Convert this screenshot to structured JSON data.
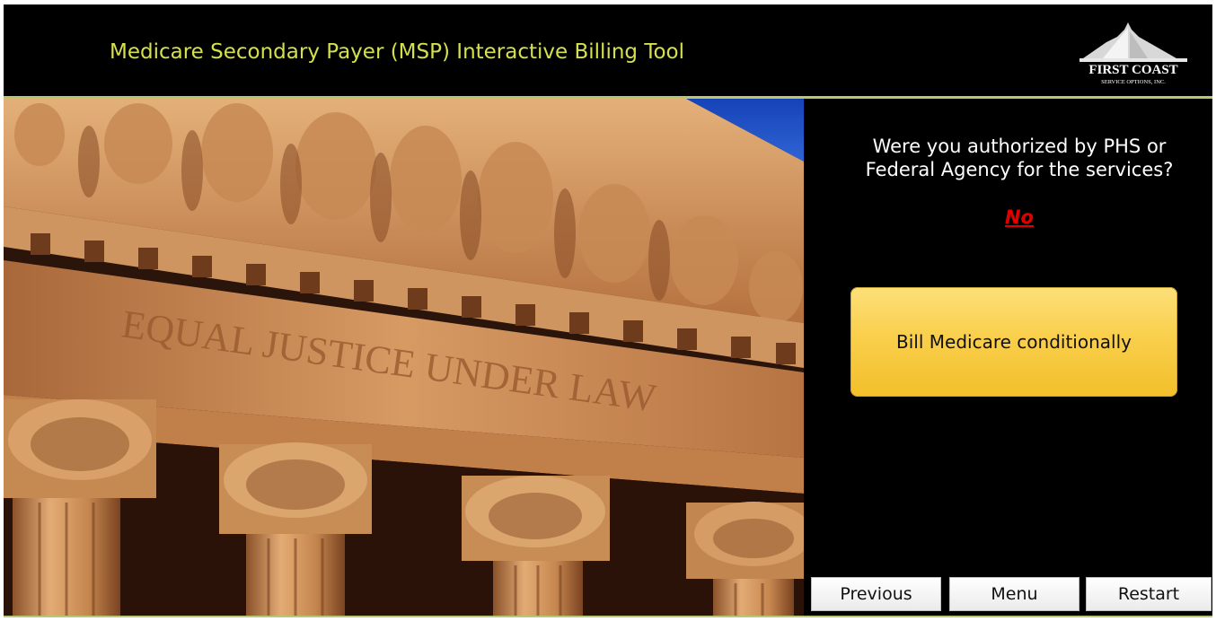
{
  "header": {
    "title": "Medicare Secondary Payer (MSP) Interactive Billing Tool",
    "logo": {
      "line1": "FIRST COAST",
      "line2": "SERVICE OPTIONS, INC."
    }
  },
  "photo": {
    "inscription": "EQUAL JUSTICE UNDER LAW"
  },
  "panel": {
    "question": "Were you authorized by PHS or Federal Agency for the services?",
    "answer": "No",
    "result_button": "Bill Medicare conditionally"
  },
  "nav": {
    "previous": "Previous",
    "menu": "Menu",
    "restart": "Restart"
  },
  "colors": {
    "title": "#d4e04c",
    "answer": "#e00000",
    "result_button": "#f9cf4c",
    "divider": "#b9c771"
  }
}
